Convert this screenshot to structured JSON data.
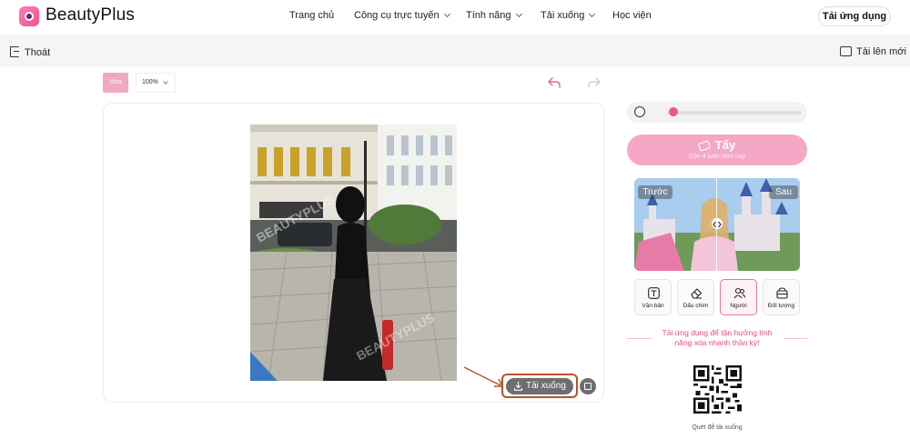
{
  "brand": {
    "name": "BeautyPlus",
    "accent": "#e45b8c"
  },
  "nav": {
    "items": [
      {
        "label": "Trang chủ",
        "dropdown": false
      },
      {
        "label": "Công cụ trực tuyến",
        "dropdown": true
      },
      {
        "label": "Tính năng",
        "dropdown": true
      },
      {
        "label": "Tải xuống",
        "dropdown": true
      },
      {
        "label": "Học viện",
        "dropdown": false
      }
    ],
    "cta": "Tải ứng dụng"
  },
  "subbar": {
    "exit": "Thoát",
    "upload_new": "Tải lên mới"
  },
  "toolbar": {
    "fit": "Vừa",
    "zoom": "100%"
  },
  "canvas": {
    "download": "Tải xuống",
    "photo": "woman in black dress walking on a street",
    "watermark": "BEAUTYPLUS"
  },
  "panel": {
    "brush_level": 0.05,
    "erase": {
      "label": "Tẩy",
      "sub": "Còn 4 lượt hôm nay"
    },
    "compare": {
      "before": "Trước",
      "after": "Sau"
    },
    "tools": [
      {
        "label": "Văn bản",
        "icon": "text-icon",
        "active": false
      },
      {
        "label": "Dấu chìm",
        "icon": "eraser-icon",
        "active": false
      },
      {
        "label": "Người",
        "icon": "people-icon",
        "active": true
      },
      {
        "label": "Đối tượng",
        "icon": "object-icon",
        "active": false
      }
    ],
    "promo": "Tải ứng dụng để tận hưởng tính năng xóa nhanh thần kỳ!",
    "qr_caption": "Quét để tải xuống"
  }
}
